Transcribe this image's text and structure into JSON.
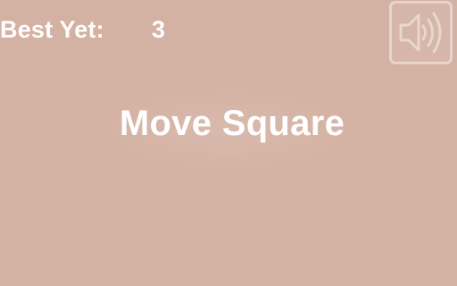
{
  "game": {
    "background_color": "#d4b2a3",
    "text_color": "#ffffff"
  },
  "hud": {
    "best_label": "Best Yet:",
    "best_value": "3",
    "sound_button_icon": "speaker-volume-icon"
  },
  "screen": {
    "title": "Move Square"
  }
}
